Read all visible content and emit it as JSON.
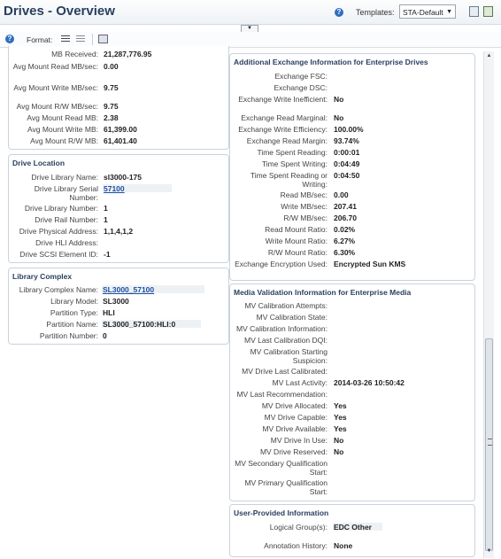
{
  "header": {
    "title": "Drives - Overview",
    "templates_label": "Templates:",
    "template_value": "STA-Default"
  },
  "toolbar": {
    "format_label": "Format:"
  },
  "drive_stats": {
    "rows": [
      {
        "label": "MB Received:",
        "value": "21,287,776.95"
      },
      {
        "label": "Avg Mount Read MB/sec:",
        "value": "0.00"
      },
      {
        "label": "Avg Mount Write MB/sec:",
        "value": "9.75"
      },
      {
        "label": "Avg Mount R/W MB/sec:",
        "value": "9.75"
      },
      {
        "label": "Avg Mount Read MB:",
        "value": "2.38"
      },
      {
        "label": "Avg Mount Write MB:",
        "value": "61,399.00"
      },
      {
        "label": "Avg Mount R/W MB:",
        "value": "61,401.40"
      }
    ]
  },
  "drive_location": {
    "title": "Drive Location",
    "rows": [
      {
        "label": "Drive Library Name:",
        "value": "sl3000-175"
      },
      {
        "label": "Drive Library Serial Number:",
        "value": "57100"
      },
      {
        "label": "Drive Library Number:",
        "value": "1"
      },
      {
        "label": "Drive Rail Number:",
        "value": "1"
      },
      {
        "label": "Drive Physical Address:",
        "value": "1,1,4,1,2"
      },
      {
        "label": "Drive HLI Address:",
        "value": ""
      },
      {
        "label": "Drive SCSI Element ID:",
        "value": "-1"
      }
    ]
  },
  "library_complex": {
    "title": "Library Complex",
    "rows": [
      {
        "label": "Library Complex Name:",
        "value": "SL3000_57100"
      },
      {
        "label": "Library Model:",
        "value": "SL3000"
      },
      {
        "label": "Partition Type:",
        "value": "HLI"
      },
      {
        "label": "Partition Name:",
        "value": "SL3000_57100:HLI:0"
      },
      {
        "label": "Partition Number:",
        "value": "0"
      }
    ]
  },
  "exchange_info": {
    "title": "Additional Exchange Information for Enterprise Drives",
    "rows": [
      {
        "label": "Exchange FSC:",
        "value": ""
      },
      {
        "label": "Exchange DSC:",
        "value": ""
      },
      {
        "label": "Exchange Write Inefficient:",
        "value": "No"
      },
      {
        "label": "Exchange Read Marginal:",
        "value": "No"
      },
      {
        "label": "Exchange Write Efficiency:",
        "value": "100.00%"
      },
      {
        "label": "Exchange Read Margin:",
        "value": "93.74%"
      },
      {
        "label": "Time Spent Reading:",
        "value": "0:00:01"
      },
      {
        "label": "Time Spent Writing:",
        "value": "0:04:49"
      },
      {
        "label": "Time Spent Reading or Writing:",
        "value": "0:04:50"
      },
      {
        "label": "Read MB/sec:",
        "value": "0.00"
      },
      {
        "label": "Write MB/sec:",
        "value": "207.41"
      },
      {
        "label": "R/W MB/sec:",
        "value": "206.70"
      },
      {
        "label": "Read Mount Ratio:",
        "value": "0.02%"
      },
      {
        "label": "Write Mount Ratio:",
        "value": "6.27%"
      },
      {
        "label": "R/W Mount Ratio:",
        "value": "6.30%"
      },
      {
        "label": "Exchange Encryption Used:",
        "value": "Encrypted Sun KMS"
      }
    ]
  },
  "media_validation": {
    "title": "Media Validation Information for Enterprise Media",
    "rows": [
      {
        "label": "MV Calibration Attempts:",
        "value": ""
      },
      {
        "label": "MV Calibration State:",
        "value": ""
      },
      {
        "label": "MV Calibration Information:",
        "value": ""
      },
      {
        "label": "MV Last Calibration DQI:",
        "value": ""
      },
      {
        "label": "MV Calibration Starting Suspicion:",
        "value": ""
      },
      {
        "label": "MV Drive Last Calibrated:",
        "value": ""
      },
      {
        "label": "MV Last Activity:",
        "value": "2014-03-26 10:50:42"
      },
      {
        "label": "MV Last Recommendation:",
        "value": ""
      },
      {
        "label": "MV Drive Allocated:",
        "value": "Yes"
      },
      {
        "label": "MV Drive Capable:",
        "value": "Yes"
      },
      {
        "label": "MV Drive Available:",
        "value": "Yes"
      },
      {
        "label": "MV Drive In Use:",
        "value": "No"
      },
      {
        "label": "MV Drive Reserved:",
        "value": "No"
      },
      {
        "label": "MV Secondary Qualification Start:",
        "value": ""
      },
      {
        "label": "MV Primary Qualification Start:",
        "value": ""
      }
    ]
  },
  "user_info": {
    "title": "User-Provided Information",
    "rows": [
      {
        "label": "Logical Group(s):",
        "value": "EDC Other"
      },
      {
        "label": "Annotation History:",
        "value": "None"
      }
    ]
  }
}
